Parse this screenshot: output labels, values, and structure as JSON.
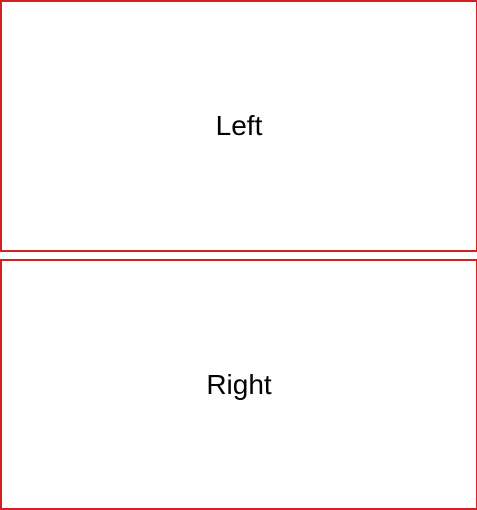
{
  "panels": [
    {
      "label": "Left"
    },
    {
      "label": "Right"
    }
  ],
  "colors": {
    "border": "#d42020",
    "background": "#ffffff",
    "text": "#000000"
  }
}
